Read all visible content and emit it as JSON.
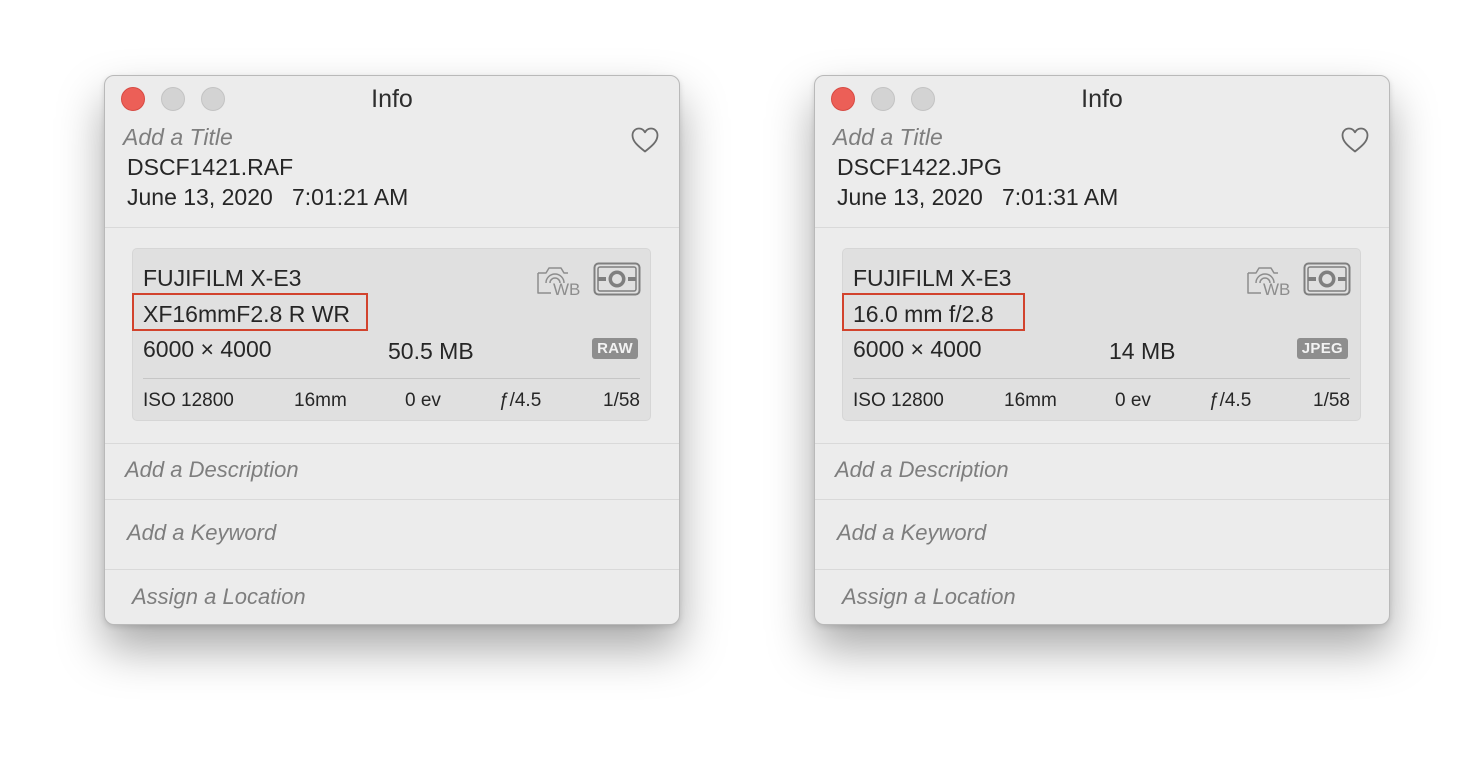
{
  "windows": [
    {
      "title": "Info",
      "title_placeholder": "Add a Title",
      "filename": "DSCF1421.RAF",
      "date": "June 13, 2020",
      "time": "7:01:21 AM",
      "camera": "FUJIFILM X-E3",
      "lens": "XF16mmF2.8 R WR",
      "dimensions": "6000 × 4000",
      "file_size": "50.5 MB",
      "format_badge": "RAW",
      "exif": {
        "iso": "ISO 12800",
        "focal": "16mm",
        "ev": "0 ev",
        "aperture": "ƒ/4.5",
        "shutter": "1/58"
      },
      "description_placeholder": "Add a Description",
      "keyword_placeholder": "Add a Keyword",
      "location_placeholder": "Assign a Location"
    },
    {
      "title": "Info",
      "title_placeholder": "Add a Title",
      "filename": "DSCF1422.JPG",
      "date": "June 13, 2020",
      "time": "7:01:31 AM",
      "camera": "FUJIFILM X-E3",
      "lens": "16.0 mm f/2.8",
      "dimensions": "6000 × 4000",
      "file_size": "14 MB",
      "format_badge": "JPEG",
      "exif": {
        "iso": "ISO 12800",
        "focal": "16mm",
        "ev": "0 ev",
        "aperture": "ƒ/4.5",
        "shutter": "1/58"
      },
      "description_placeholder": "Add a Description",
      "keyword_placeholder": "Add a Keyword",
      "location_placeholder": "Assign a Location"
    }
  ],
  "icons": {
    "close": "close-button",
    "minimize": "minimize-button",
    "zoom": "zoom-button",
    "favorite": "heart-icon",
    "white_balance": "camera-wb-icon",
    "metering": "metering-mode-icon"
  },
  "colors": {
    "highlight_box": "#d2432d",
    "close_light": "#ec5f57",
    "badge": "#8e8e8e"
  }
}
